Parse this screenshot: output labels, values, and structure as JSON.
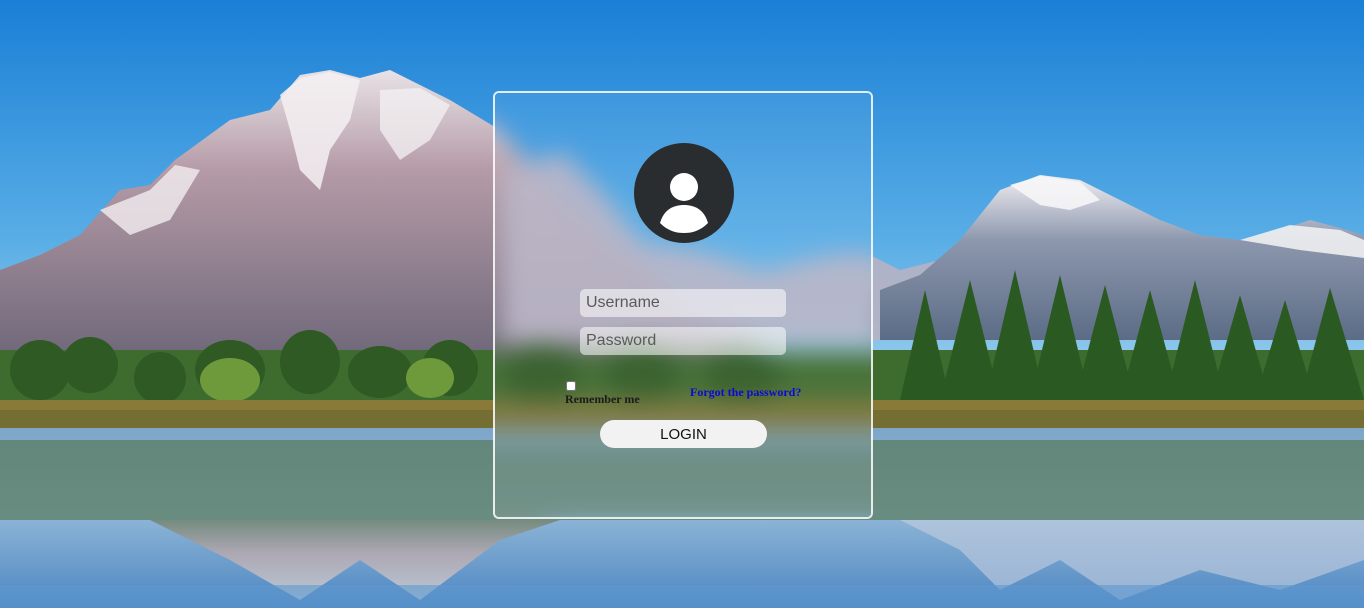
{
  "login_form": {
    "username_placeholder": "Username",
    "password_placeholder": "Password",
    "remember_label": "Remember me",
    "remember_checked": false,
    "forgot_label": "Forgot the password?",
    "login_label": "LOGIN"
  },
  "icons": {
    "avatar": "user-circle-icon"
  },
  "colors": {
    "sky_top": "#1a7fd6",
    "sky_bottom": "#a9d3ee",
    "card_border": "#ffffff",
    "avatar_bg": "#2a2d30",
    "forgot_link": "#0a0ad6",
    "login_button_bg": "#f2f2f2"
  }
}
